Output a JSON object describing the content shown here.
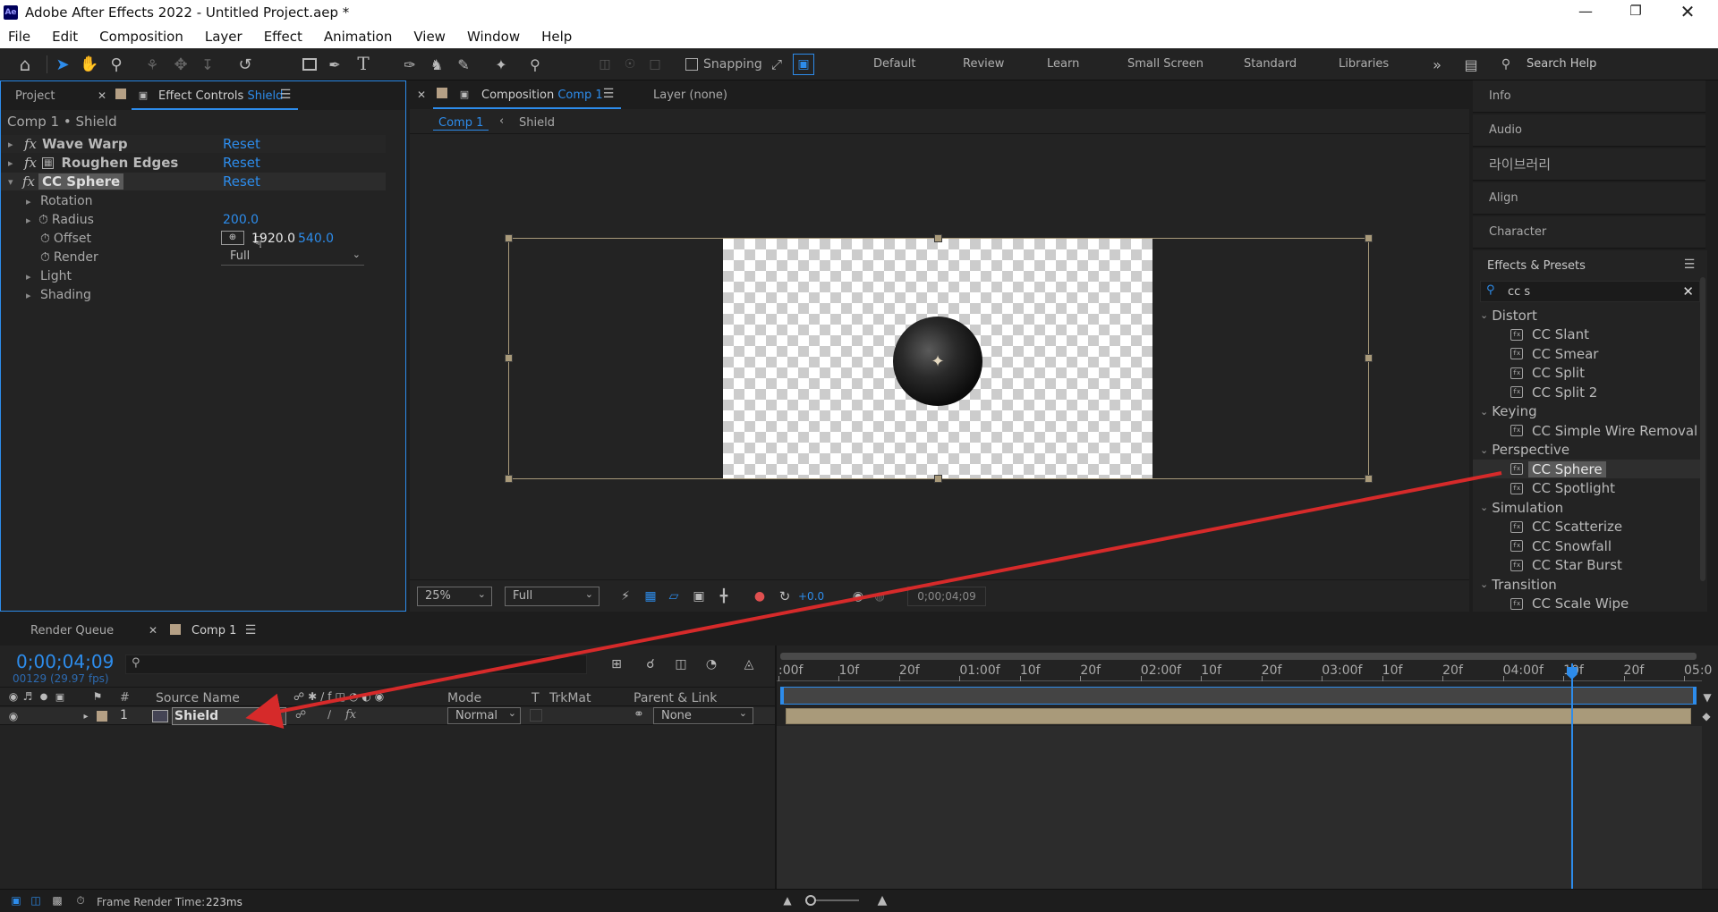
{
  "app": {
    "title": "Adobe After Effects 2022 - Untitled Project.aep *",
    "logo": "Ae"
  },
  "menu": [
    "File",
    "Edit",
    "Composition",
    "Layer",
    "Effect",
    "Animation",
    "View",
    "Window",
    "Help"
  ],
  "toolbar": {
    "snapping_label": "Snapping",
    "search_placeholder": "Search Help"
  },
  "workspaces": [
    "Default",
    "Review",
    "Learn",
    "Small Screen",
    "Standard",
    "Libraries"
  ],
  "left_panel": {
    "tab_project": "Project",
    "tab_effect_controls": "Effect Controls",
    "tab_effect_controls_layer": "Shield",
    "header": "Comp 1 • Shield",
    "effects": [
      {
        "name": "Wave Warp",
        "reset": "Reset"
      },
      {
        "name": "Roughen Edges",
        "reset": "Reset"
      },
      {
        "name": "CC Sphere",
        "reset": "Reset"
      }
    ],
    "props": {
      "rotation": "Rotation",
      "radius_label": "Radius",
      "radius_value": "200.0",
      "offset_label": "Offset",
      "offset_x": "1920.0",
      "offset_y": "540.0",
      "render_label": "Render",
      "render_value": "Full",
      "light": "Light",
      "shading": "Shading"
    }
  },
  "viewer": {
    "tab_composition": "Composition",
    "tab_comp_name": "Comp 1",
    "layer_tab": "Layer (none)",
    "crumb_comp": "Comp 1",
    "crumb_layer": "Shield",
    "zoom": "25%",
    "resolution": "Full",
    "exposure": "+0.0",
    "timecode": "0;00;04;09"
  },
  "right_panel": {
    "items": [
      "Info",
      "Audio",
      "라이브러리",
      "Align",
      "Character"
    ],
    "effects_presets_title": "Effects & Presets",
    "search_value": "cc s",
    "categories": [
      {
        "name": "Distort",
        "items": [
          "CC Slant",
          "CC Smear",
          "CC Split",
          "CC Split 2"
        ]
      },
      {
        "name": "Keying",
        "items": [
          "CC Simple Wire Removal"
        ]
      },
      {
        "name": "Perspective",
        "items": [
          "CC Sphere",
          "CC Spotlight"
        ]
      },
      {
        "name": "Simulation",
        "items": [
          "CC Scatterize",
          "CC Snowfall",
          "CC Star Burst"
        ]
      },
      {
        "name": "Transition",
        "items": [
          "CC Scale Wipe"
        ]
      }
    ]
  },
  "timeline": {
    "tab_render_queue": "Render Queue",
    "tab_comp": "Comp 1",
    "timecode": "0;00;04;09",
    "frame_info": "00129 (29.97 fps)",
    "columns": {
      "num": "#",
      "source_name": "Source Name",
      "mode": "Mode",
      "t": "T",
      "trkmat": "TrkMat",
      "parent_link": "Parent & Link"
    },
    "layer": {
      "index": "1",
      "name": "Shield",
      "mode": "Normal",
      "parent": "None"
    },
    "ruler_labels": [
      ":00f",
      "10f",
      "20f",
      "01:00f",
      "10f",
      "20f",
      "02:00f",
      "10f",
      "20f",
      "03:00f",
      "10f",
      "20f",
      "04:00f",
      "10f",
      "20f",
      "05:0"
    ],
    "playhead_fraction": 0.864,
    "frame_render_label": "Frame Render Time:",
    "frame_render_value": "223ms"
  },
  "colors": {
    "accent": "#2d8ceb",
    "layer_bar": "#a99a7a",
    "annotation_arrow": "#d62a2a",
    "panel_bg": "#232323"
  }
}
